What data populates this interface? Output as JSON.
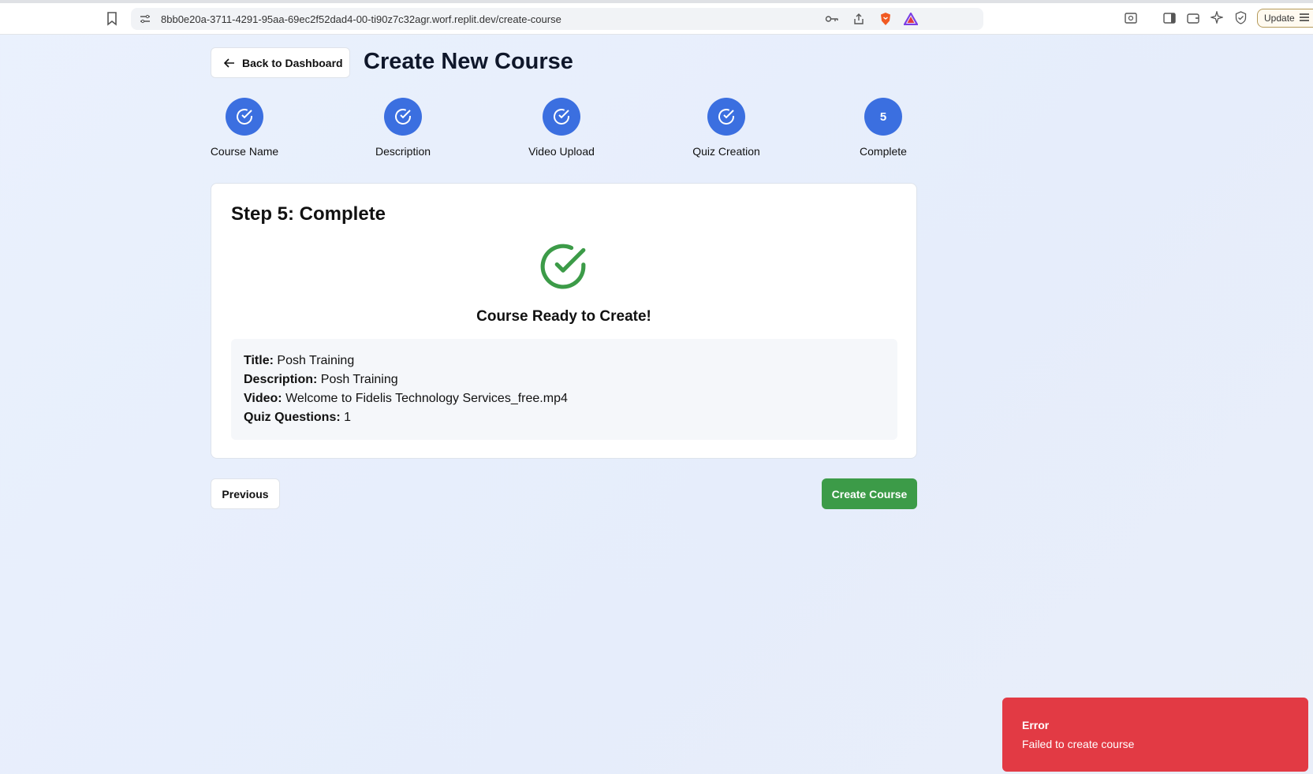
{
  "browser": {
    "url": "8bb0e20a-3711-4291-95aa-69ec2f52dad4-00-ti90z7c32agr.worf.replit.dev/create-course",
    "update_label": "Update"
  },
  "header": {
    "back_label": "Back to Dashboard",
    "title": "Create New Course"
  },
  "steps": [
    {
      "label": "Course Name",
      "status": "done"
    },
    {
      "label": "Description",
      "status": "done"
    },
    {
      "label": "Video Upload",
      "status": "done"
    },
    {
      "label": "Quiz Creation",
      "status": "done"
    },
    {
      "label": "Complete",
      "number": "5",
      "status": "current"
    }
  ],
  "card": {
    "title": "Step 5: Complete",
    "ready_text": "Course Ready to Create!",
    "summary": {
      "title_label": "Title:",
      "title_value": "Posh Training",
      "description_label": "Description:",
      "description_value": "Posh Training",
      "video_label": "Video:",
      "video_value": "Welcome to Fidelis Technology Services_free.mp4",
      "quiz_label": "Quiz Questions:",
      "quiz_value": "1"
    }
  },
  "actions": {
    "previous_label": "Previous",
    "create_label": "Create Course"
  },
  "toast": {
    "title": "Error",
    "message": "Failed to create course"
  },
  "colors": {
    "primary": "#3b6fe0",
    "success": "#3c9b48",
    "error": "#e23a44"
  }
}
